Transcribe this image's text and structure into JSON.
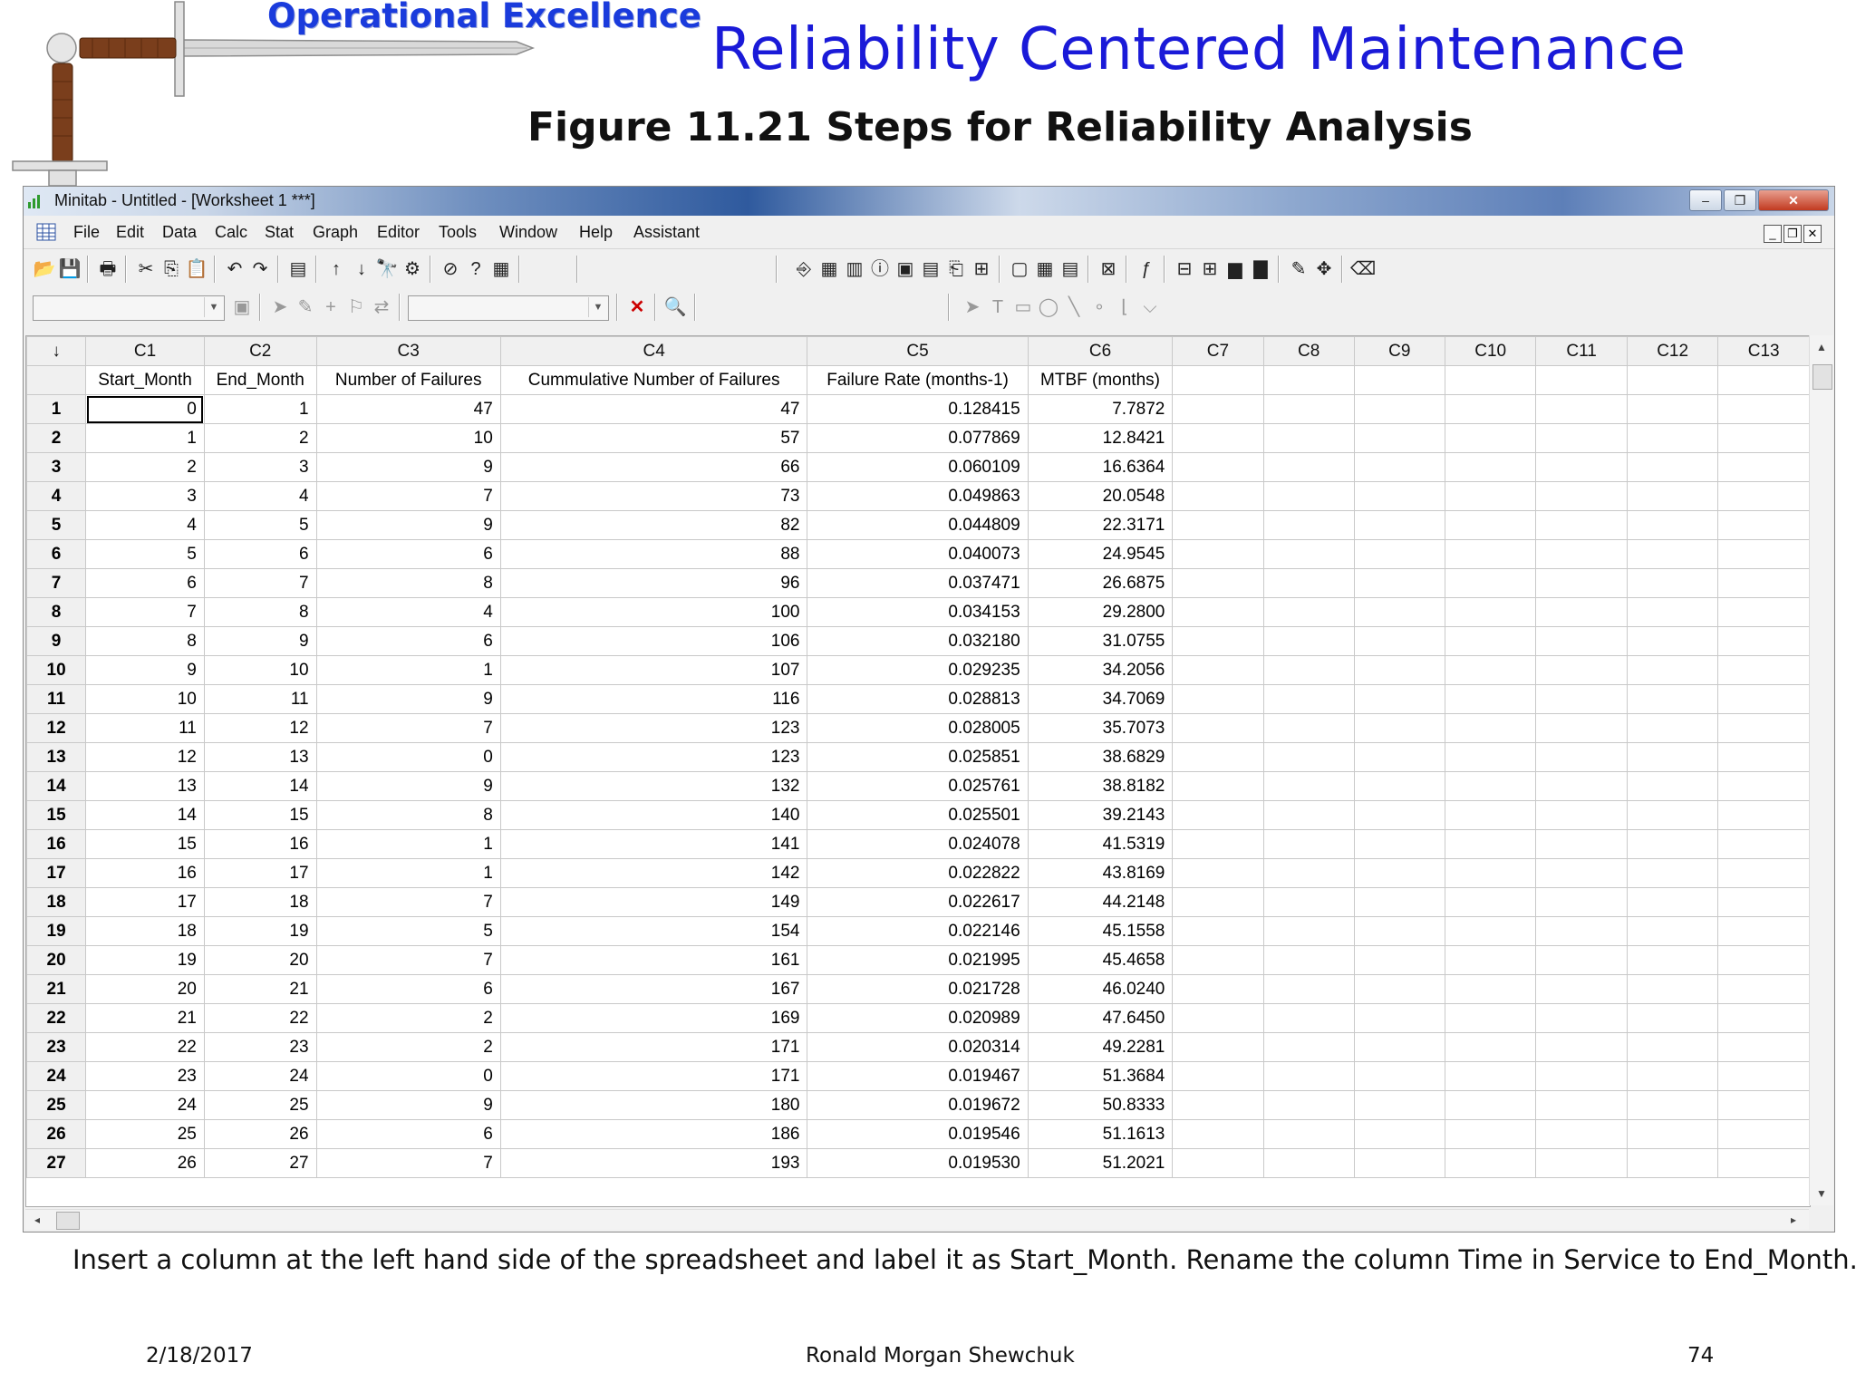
{
  "slide": {
    "brand": "Operational Excellence",
    "title": "Reliability Centered Maintenance",
    "figure_title": "Figure 11.21  Steps for Reliability Analysis",
    "caption": "Insert a column at the left hand side of the spreadsheet and label it as Start_Month.  Rename the column Time in Service to End_Month.",
    "footer": {
      "date": "2/18/2017",
      "author": "Ronald Morgan Shewchuk",
      "page": "74"
    }
  },
  "window": {
    "title": "Minitab - Untitled - [Worksheet 1 ***]",
    "controls": {
      "minimize": "–",
      "restore": "❐",
      "close": "✕"
    },
    "mdi_controls": {
      "minimize": "_",
      "restore": "❐",
      "close": "✕"
    }
  },
  "menu": [
    "File",
    "Edit",
    "Data",
    "Calc",
    "Stat",
    "Graph",
    "Editor",
    "Tools",
    "Window",
    "Help",
    "Assistant"
  ],
  "sheet": {
    "corner": "↓",
    "columns": [
      "C1",
      "C2",
      "C3",
      "C4",
      "C5",
      "C6",
      "C7",
      "C8",
      "C9",
      "C10",
      "C11",
      "C12",
      "C13"
    ],
    "names": [
      "Start_Month",
      "End_Month",
      "Number of Failures",
      "Cummulative Number of Failures",
      "Failure Rate (months-1)",
      "MTBF (months)",
      "",
      "",
      "",
      "",
      "",
      "",
      ""
    ],
    "rows": [
      [
        "1",
        "0",
        "1",
        "47",
        "47",
        "0.128415",
        "7.7872"
      ],
      [
        "2",
        "1",
        "2",
        "10",
        "57",
        "0.077869",
        "12.8421"
      ],
      [
        "3",
        "2",
        "3",
        "9",
        "66",
        "0.060109",
        "16.6364"
      ],
      [
        "4",
        "3",
        "4",
        "7",
        "73",
        "0.049863",
        "20.0548"
      ],
      [
        "5",
        "4",
        "5",
        "9",
        "82",
        "0.044809",
        "22.3171"
      ],
      [
        "6",
        "5",
        "6",
        "6",
        "88",
        "0.040073",
        "24.9545"
      ],
      [
        "7",
        "6",
        "7",
        "8",
        "96",
        "0.037471",
        "26.6875"
      ],
      [
        "8",
        "7",
        "8",
        "4",
        "100",
        "0.034153",
        "29.2800"
      ],
      [
        "9",
        "8",
        "9",
        "6",
        "106",
        "0.032180",
        "31.0755"
      ],
      [
        "10",
        "9",
        "10",
        "1",
        "107",
        "0.029235",
        "34.2056"
      ],
      [
        "11",
        "10",
        "11",
        "9",
        "116",
        "0.028813",
        "34.7069"
      ],
      [
        "12",
        "11",
        "12",
        "7",
        "123",
        "0.028005",
        "35.7073"
      ],
      [
        "13",
        "12",
        "13",
        "0",
        "123",
        "0.025851",
        "38.6829"
      ],
      [
        "14",
        "13",
        "14",
        "9",
        "132",
        "0.025761",
        "38.8182"
      ],
      [
        "15",
        "14",
        "15",
        "8",
        "140",
        "0.025501",
        "39.2143"
      ],
      [
        "16",
        "15",
        "16",
        "1",
        "141",
        "0.024078",
        "41.5319"
      ],
      [
        "17",
        "16",
        "17",
        "1",
        "142",
        "0.022822",
        "43.8169"
      ],
      [
        "18",
        "17",
        "18",
        "7",
        "149",
        "0.022617",
        "44.2148"
      ],
      [
        "19",
        "18",
        "19",
        "5",
        "154",
        "0.022146",
        "45.1558"
      ],
      [
        "20",
        "19",
        "20",
        "7",
        "161",
        "0.021995",
        "45.4658"
      ],
      [
        "21",
        "20",
        "21",
        "6",
        "167",
        "0.021728",
        "46.0240"
      ],
      [
        "22",
        "21",
        "22",
        "2",
        "169",
        "0.020989",
        "47.6450"
      ],
      [
        "23",
        "22",
        "23",
        "2",
        "171",
        "0.020314",
        "49.2281"
      ],
      [
        "24",
        "23",
        "24",
        "0",
        "171",
        "0.019467",
        "51.3684"
      ],
      [
        "25",
        "24",
        "25",
        "9",
        "180",
        "0.019672",
        "50.8333"
      ],
      [
        "26",
        "25",
        "26",
        "6",
        "186",
        "0.019546",
        "51.1613"
      ],
      [
        "27",
        "26",
        "27",
        "7",
        "193",
        "0.019530",
        "51.2021"
      ]
    ]
  },
  "icons": {
    "toolbar1": [
      "open-icon",
      "save-icon",
      "print-icon",
      "cut-icon",
      "copy-icon",
      "paste-icon",
      "undo-icon",
      "redo-icon",
      "edit-last-dialog-icon",
      "previous-icon",
      "next-icon",
      "find-icon",
      "replace-icon",
      "cancel-icon",
      "help-icon",
      "stat-guide-icon",
      "session-window-icon",
      "worksheet-icon",
      "project-manager-icon",
      "info-icon",
      "history-icon",
      "report-pad-icon",
      "related-documents-icon",
      "design-icon",
      "show-session-icon",
      "show-worksheet-icon",
      "show-graphs-icon",
      "close-graphs-icon",
      "calculator-icon",
      "insert-cells-icon",
      "insert-rows-icon",
      "bar-chart-icon",
      "chart-icon",
      "brush-icon",
      "crosshair-icon",
      "eraser-icon"
    ],
    "toolbar2": [
      "edit-icon",
      "select-icon",
      "brush-icon",
      "crosshair-icon",
      "flag-icon",
      "swap-icon",
      "delete-red-icon",
      "zoom-icon",
      "arrow-tool-icon",
      "text-tool-icon",
      "rectangle-tool-icon",
      "ellipse-tool-icon",
      "line-tool-icon",
      "marker-tool-icon",
      "polyline-tool-icon",
      "polygon-tool-icon"
    ]
  },
  "colors": {
    "brand": "#1a3bdc",
    "title": "#1a1ad8"
  }
}
